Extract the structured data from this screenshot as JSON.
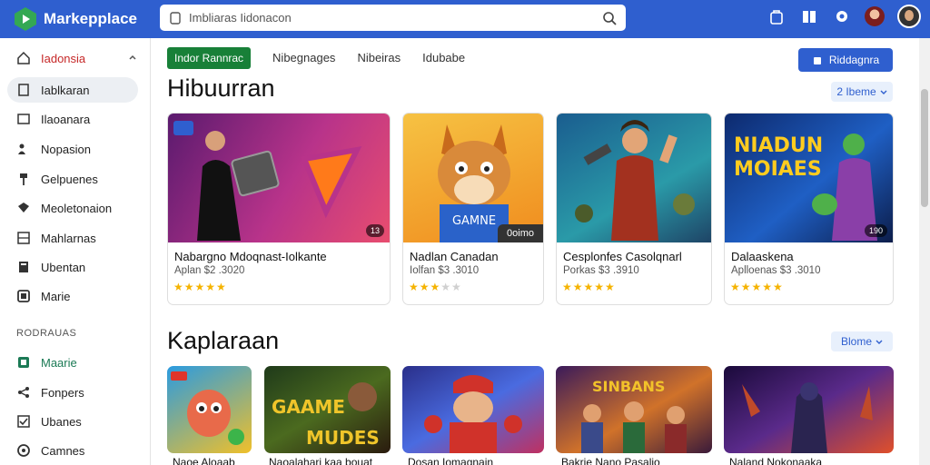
{
  "header": {
    "brand": "Markepplace",
    "search_value": "Imbliaras Iidonacon",
    "icons": [
      "bag-icon",
      "book-icon",
      "settings-icon",
      "profile-icon",
      "avatar"
    ]
  },
  "sidebar": {
    "items": [
      {
        "label": "Iadonsia",
        "icon": "home-icon"
      },
      {
        "label": "Iablkaran",
        "icon": "doc-icon"
      },
      {
        "label": "Ilaoanara",
        "icon": "doc-icon"
      },
      {
        "label": "Nopasion",
        "icon": "people-icon"
      },
      {
        "label": "Gelpuenes",
        "icon": "pin-icon"
      },
      {
        "label": "Meoletonaion",
        "icon": "tag-icon"
      },
      {
        "label": "Mahlarnas",
        "icon": "grid-icon"
      },
      {
        "label": "Ubentan",
        "icon": "book-icon"
      },
      {
        "label": "Marie",
        "icon": "square-icon"
      }
    ],
    "section_label": "RODRAUAS",
    "section_items": [
      {
        "label": "Maarie",
        "icon": "square-icon"
      },
      {
        "label": "Fonpers",
        "icon": "share-icon"
      },
      {
        "label": "Ubanes",
        "icon": "check-icon"
      },
      {
        "label": "Camnes",
        "icon": "circle-icon"
      }
    ]
  },
  "toolbar": {
    "tabs": [
      "Indor Rannrac",
      "Nibegnages",
      "Nibeiras",
      "Idubabe"
    ],
    "primary_button": "Riddagnra"
  },
  "section1": {
    "title": "Hibuurran",
    "more_label": "2 Ibeme"
  },
  "cards": [
    {
      "title": "Nabargno Mdoqnast-Iolkante",
      "meta": "Aplan  $2 .3020",
      "rating": 5,
      "badge": "13"
    },
    {
      "title": "Nadlan Canadan",
      "meta": "Iolfan  $3 .3010",
      "rating": 3.5,
      "badge": "0oimo"
    },
    {
      "title": "Cesplonfes Casolqnarl",
      "meta": "Porkas  $3 .3910",
      "rating": 5,
      "badge": ""
    },
    {
      "title": "Dalaaskena",
      "meta": "Aplloenas  $3 .3010",
      "rating": 5,
      "badge": "190"
    }
  ],
  "section2": {
    "title": "Kaplaraan",
    "more_label": "Blome"
  },
  "tiles": [
    {
      "title": "Naoe Aloaab"
    },
    {
      "title": "Naoalahari kaa bouat"
    },
    {
      "title": "Dosan Iomagnain"
    },
    {
      "title": "Bakrie Nano Pasalio"
    },
    {
      "title": "Naland Nokonaaka"
    }
  ],
  "colors": {
    "brand": "#2f5fcf",
    "tab_active": "#188038",
    "star": "#f5b300"
  }
}
